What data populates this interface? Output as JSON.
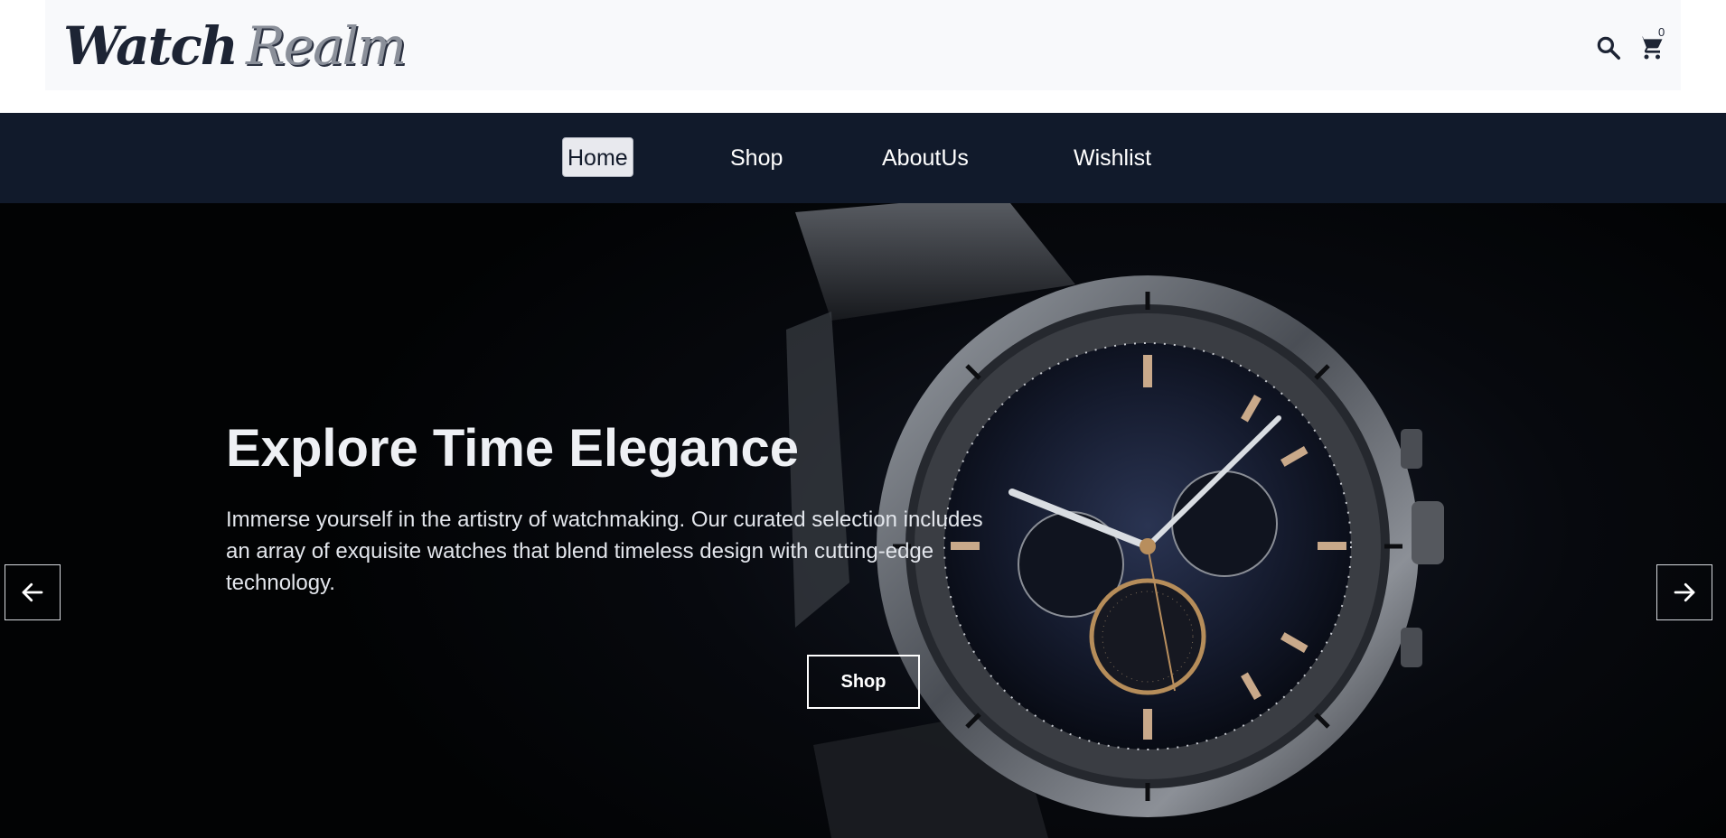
{
  "brand": {
    "word1": "Watch",
    "word2": "Realm"
  },
  "header": {
    "cart_count": "0",
    "search_icon": "search-icon",
    "cart_icon": "cart-icon"
  },
  "nav": {
    "items": [
      {
        "label": "Home",
        "active": true
      },
      {
        "label": "Shop",
        "active": false
      },
      {
        "label": "AboutUs",
        "active": false
      },
      {
        "label": "Wishlist",
        "active": false
      }
    ]
  },
  "hero": {
    "title": "Explore Time Elegance",
    "text": "Immerse yourself in the artistry of watchmaking. Our curated selection includes an array of exquisite watches that blend timeless design with cutting-edge technology.",
    "button": "Shop",
    "prev_icon": "arrow-left-icon",
    "next_icon": "arrow-right-icon"
  },
  "colors": {
    "nav_bg": "#111a2b",
    "header_bg": "#f8f9fb",
    "hero_bg": "#05070b",
    "active_nav_bg": "#e8e9ee"
  }
}
